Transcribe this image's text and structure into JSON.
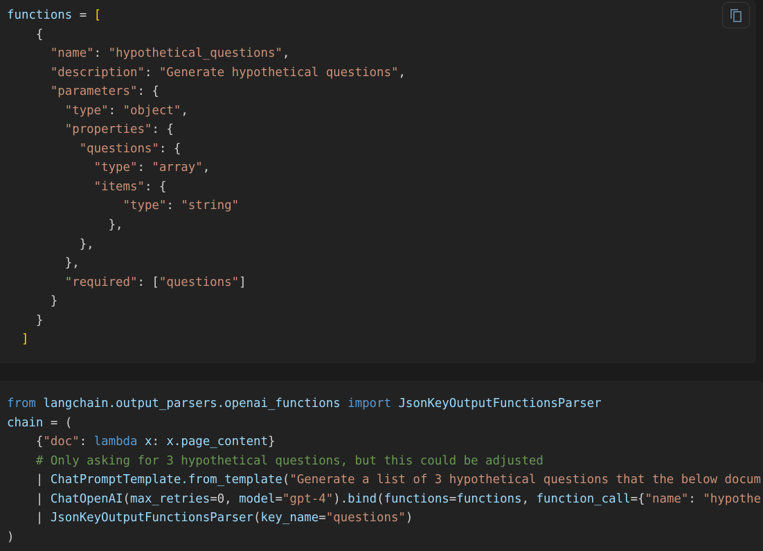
{
  "colors": {
    "background": "#222222",
    "variable": "#9cdcfe",
    "string": "#ce9178",
    "keyword": "#569cd6",
    "comment": "#6a9955",
    "bracket": "#ffd700"
  },
  "copy_button": {
    "icon": "copy-icon"
  },
  "blocks": [
    {
      "lines": [
        [
          [
            "var",
            "functions"
          ],
          [
            "p",
            " = "
          ],
          [
            "br",
            "["
          ]
        ],
        [
          [
            "p",
            "    {"
          ]
        ],
        [
          [
            "p",
            "      "
          ],
          [
            "str",
            "\"name\""
          ],
          [
            "p",
            ": "
          ],
          [
            "str",
            "\"hypothetical_questions\""
          ],
          [
            "p",
            ","
          ]
        ],
        [
          [
            "p",
            "      "
          ],
          [
            "str",
            "\"description\""
          ],
          [
            "p",
            ": "
          ],
          [
            "str",
            "\"Generate hypothetical questions\""
          ],
          [
            "p",
            ","
          ]
        ],
        [
          [
            "p",
            "      "
          ],
          [
            "str",
            "\"parameters\""
          ],
          [
            "p",
            ": {"
          ]
        ],
        [
          [
            "p",
            "        "
          ],
          [
            "str",
            "\"type\""
          ],
          [
            "p",
            ": "
          ],
          [
            "str",
            "\"object\""
          ],
          [
            "p",
            ","
          ]
        ],
        [
          [
            "p",
            "        "
          ],
          [
            "str",
            "\"properties\""
          ],
          [
            "p",
            ": {"
          ]
        ],
        [
          [
            "p",
            "          "
          ],
          [
            "str",
            "\"questions\""
          ],
          [
            "p",
            ": {"
          ]
        ],
        [
          [
            "p",
            "            "
          ],
          [
            "str",
            "\"type\""
          ],
          [
            "p",
            ": "
          ],
          [
            "str",
            "\"array\""
          ],
          [
            "p",
            ","
          ]
        ],
        [
          [
            "p",
            "            "
          ],
          [
            "str",
            "\"items\""
          ],
          [
            "p",
            ": {"
          ]
        ],
        [
          [
            "p",
            "                "
          ],
          [
            "str",
            "\"type\""
          ],
          [
            "p",
            ": "
          ],
          [
            "str",
            "\"string\""
          ]
        ],
        [
          [
            "p",
            "              },"
          ]
        ],
        [
          [
            "p",
            "          },"
          ]
        ],
        [
          [
            "p",
            "        },"
          ]
        ],
        [
          [
            "p",
            "        "
          ],
          [
            "str",
            "\"required\""
          ],
          [
            "p",
            ": ["
          ],
          [
            "str",
            "\"questions\""
          ],
          [
            "p",
            "]"
          ]
        ],
        [
          [
            "p",
            "      }"
          ]
        ],
        [
          [
            "p",
            "    }"
          ]
        ],
        [
          [
            "p",
            "  "
          ],
          [
            "br",
            "]"
          ]
        ]
      ]
    },
    {
      "lines": [
        [
          [
            "kw",
            "from"
          ],
          [
            "p",
            " "
          ],
          [
            "var",
            "langchain.output_parsers.openai_functions"
          ],
          [
            "p",
            " "
          ],
          [
            "kw",
            "import"
          ],
          [
            "p",
            " "
          ],
          [
            "var",
            "JsonKeyOutputFunctionsParser"
          ]
        ],
        [
          [
            "var",
            "chain"
          ],
          [
            "p",
            " = ("
          ]
        ],
        [
          [
            "p",
            "    {"
          ],
          [
            "str",
            "\"doc\""
          ],
          [
            "p",
            ": "
          ],
          [
            "kw",
            "lambda"
          ],
          [
            "p",
            " "
          ],
          [
            "var",
            "x"
          ],
          [
            "p",
            ": "
          ],
          [
            "var",
            "x.page_content"
          ],
          [
            "p",
            "}"
          ]
        ],
        [
          [
            "cmt",
            "    # Only asking for 3 hypothetical questions, but this could be adjusted"
          ]
        ],
        [
          [
            "p",
            "    | "
          ],
          [
            "fn",
            "ChatPromptTemplate.from_template"
          ],
          [
            "p",
            "("
          ],
          [
            "str",
            "\"Generate a list of 3 hypothetical questions that the below docum"
          ]
        ],
        [
          [
            "p",
            "    | "
          ],
          [
            "fn",
            "ChatOpenAI"
          ],
          [
            "p",
            "("
          ],
          [
            "var",
            "max_retries"
          ],
          [
            "p",
            "=0, "
          ],
          [
            "var",
            "model"
          ],
          [
            "p",
            "="
          ],
          [
            "str",
            "\"gpt-4\""
          ],
          [
            "p",
            ")."
          ],
          [
            "fn",
            "bind"
          ],
          [
            "p",
            "("
          ],
          [
            "var",
            "functions"
          ],
          [
            "p",
            "="
          ],
          [
            "var",
            "functions"
          ],
          [
            "p",
            ", "
          ],
          [
            "var",
            "function_call"
          ],
          [
            "p",
            "={"
          ],
          [
            "str",
            "\"name\""
          ],
          [
            "p",
            ": "
          ],
          [
            "str",
            "\"hypothe"
          ]
        ],
        [
          [
            "p",
            "    | "
          ],
          [
            "fn",
            "JsonKeyOutputFunctionsParser"
          ],
          [
            "p",
            "("
          ],
          [
            "var",
            "key_name"
          ],
          [
            "p",
            "="
          ],
          [
            "str",
            "\"questions\""
          ],
          [
            "p",
            ")"
          ]
        ],
        [
          [
            "p",
            ")"
          ]
        ]
      ]
    }
  ]
}
